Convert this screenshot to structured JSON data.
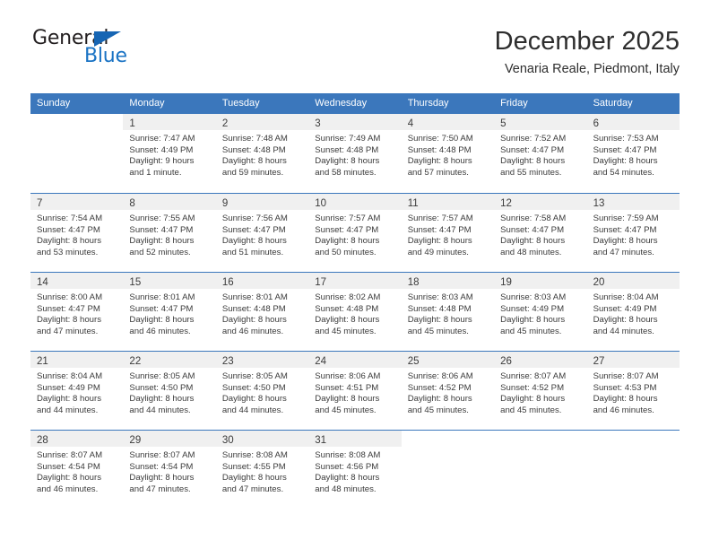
{
  "brand": {
    "name_part1": "General",
    "name_part2": "Blue",
    "triangle_color": "#1665b3",
    "blue_color": "#1a73c4"
  },
  "header": {
    "title": "December 2025",
    "subtitle": "Venaria Reale, Piedmont, Italy"
  },
  "theme": {
    "header_band": "#3b77bc",
    "daynum_band": "#f0f0f0",
    "text": "#3b3b3b"
  },
  "weekdays": [
    "Sunday",
    "Monday",
    "Tuesday",
    "Wednesday",
    "Thursday",
    "Friday",
    "Saturday"
  ],
  "weeks": [
    [
      {
        "empty": true
      },
      {
        "day": "1",
        "sunrise": "Sunrise: 7:47 AM",
        "sunset": "Sunset: 4:49 PM",
        "daylight1": "Daylight: 9 hours",
        "daylight2": "and 1 minute."
      },
      {
        "day": "2",
        "sunrise": "Sunrise: 7:48 AM",
        "sunset": "Sunset: 4:48 PM",
        "daylight1": "Daylight: 8 hours",
        "daylight2": "and 59 minutes."
      },
      {
        "day": "3",
        "sunrise": "Sunrise: 7:49 AM",
        "sunset": "Sunset: 4:48 PM",
        "daylight1": "Daylight: 8 hours",
        "daylight2": "and 58 minutes."
      },
      {
        "day": "4",
        "sunrise": "Sunrise: 7:50 AM",
        "sunset": "Sunset: 4:48 PM",
        "daylight1": "Daylight: 8 hours",
        "daylight2": "and 57 minutes."
      },
      {
        "day": "5",
        "sunrise": "Sunrise: 7:52 AM",
        "sunset": "Sunset: 4:47 PM",
        "daylight1": "Daylight: 8 hours",
        "daylight2": "and 55 minutes."
      },
      {
        "day": "6",
        "sunrise": "Sunrise: 7:53 AM",
        "sunset": "Sunset: 4:47 PM",
        "daylight1": "Daylight: 8 hours",
        "daylight2": "and 54 minutes."
      }
    ],
    [
      {
        "day": "7",
        "sunrise": "Sunrise: 7:54 AM",
        "sunset": "Sunset: 4:47 PM",
        "daylight1": "Daylight: 8 hours",
        "daylight2": "and 53 minutes."
      },
      {
        "day": "8",
        "sunrise": "Sunrise: 7:55 AM",
        "sunset": "Sunset: 4:47 PM",
        "daylight1": "Daylight: 8 hours",
        "daylight2": "and 52 minutes."
      },
      {
        "day": "9",
        "sunrise": "Sunrise: 7:56 AM",
        "sunset": "Sunset: 4:47 PM",
        "daylight1": "Daylight: 8 hours",
        "daylight2": "and 51 minutes."
      },
      {
        "day": "10",
        "sunrise": "Sunrise: 7:57 AM",
        "sunset": "Sunset: 4:47 PM",
        "daylight1": "Daylight: 8 hours",
        "daylight2": "and 50 minutes."
      },
      {
        "day": "11",
        "sunrise": "Sunrise: 7:57 AM",
        "sunset": "Sunset: 4:47 PM",
        "daylight1": "Daylight: 8 hours",
        "daylight2": "and 49 minutes."
      },
      {
        "day": "12",
        "sunrise": "Sunrise: 7:58 AM",
        "sunset": "Sunset: 4:47 PM",
        "daylight1": "Daylight: 8 hours",
        "daylight2": "and 48 minutes."
      },
      {
        "day": "13",
        "sunrise": "Sunrise: 7:59 AM",
        "sunset": "Sunset: 4:47 PM",
        "daylight1": "Daylight: 8 hours",
        "daylight2": "and 47 minutes."
      }
    ],
    [
      {
        "day": "14",
        "sunrise": "Sunrise: 8:00 AM",
        "sunset": "Sunset: 4:47 PM",
        "daylight1": "Daylight: 8 hours",
        "daylight2": "and 47 minutes."
      },
      {
        "day": "15",
        "sunrise": "Sunrise: 8:01 AM",
        "sunset": "Sunset: 4:47 PM",
        "daylight1": "Daylight: 8 hours",
        "daylight2": "and 46 minutes."
      },
      {
        "day": "16",
        "sunrise": "Sunrise: 8:01 AM",
        "sunset": "Sunset: 4:48 PM",
        "daylight1": "Daylight: 8 hours",
        "daylight2": "and 46 minutes."
      },
      {
        "day": "17",
        "sunrise": "Sunrise: 8:02 AM",
        "sunset": "Sunset: 4:48 PM",
        "daylight1": "Daylight: 8 hours",
        "daylight2": "and 45 minutes."
      },
      {
        "day": "18",
        "sunrise": "Sunrise: 8:03 AM",
        "sunset": "Sunset: 4:48 PM",
        "daylight1": "Daylight: 8 hours",
        "daylight2": "and 45 minutes."
      },
      {
        "day": "19",
        "sunrise": "Sunrise: 8:03 AM",
        "sunset": "Sunset: 4:49 PM",
        "daylight1": "Daylight: 8 hours",
        "daylight2": "and 45 minutes."
      },
      {
        "day": "20",
        "sunrise": "Sunrise: 8:04 AM",
        "sunset": "Sunset: 4:49 PM",
        "daylight1": "Daylight: 8 hours",
        "daylight2": "and 44 minutes."
      }
    ],
    [
      {
        "day": "21",
        "sunrise": "Sunrise: 8:04 AM",
        "sunset": "Sunset: 4:49 PM",
        "daylight1": "Daylight: 8 hours",
        "daylight2": "and 44 minutes."
      },
      {
        "day": "22",
        "sunrise": "Sunrise: 8:05 AM",
        "sunset": "Sunset: 4:50 PM",
        "daylight1": "Daylight: 8 hours",
        "daylight2": "and 44 minutes."
      },
      {
        "day": "23",
        "sunrise": "Sunrise: 8:05 AM",
        "sunset": "Sunset: 4:50 PM",
        "daylight1": "Daylight: 8 hours",
        "daylight2": "and 44 minutes."
      },
      {
        "day": "24",
        "sunrise": "Sunrise: 8:06 AM",
        "sunset": "Sunset: 4:51 PM",
        "daylight1": "Daylight: 8 hours",
        "daylight2": "and 45 minutes."
      },
      {
        "day": "25",
        "sunrise": "Sunrise: 8:06 AM",
        "sunset": "Sunset: 4:52 PM",
        "daylight1": "Daylight: 8 hours",
        "daylight2": "and 45 minutes."
      },
      {
        "day": "26",
        "sunrise": "Sunrise: 8:07 AM",
        "sunset": "Sunset: 4:52 PM",
        "daylight1": "Daylight: 8 hours",
        "daylight2": "and 45 minutes."
      },
      {
        "day": "27",
        "sunrise": "Sunrise: 8:07 AM",
        "sunset": "Sunset: 4:53 PM",
        "daylight1": "Daylight: 8 hours",
        "daylight2": "and 46 minutes."
      }
    ],
    [
      {
        "day": "28",
        "sunrise": "Sunrise: 8:07 AM",
        "sunset": "Sunset: 4:54 PM",
        "daylight1": "Daylight: 8 hours",
        "daylight2": "and 46 minutes."
      },
      {
        "day": "29",
        "sunrise": "Sunrise: 8:07 AM",
        "sunset": "Sunset: 4:54 PM",
        "daylight1": "Daylight: 8 hours",
        "daylight2": "and 47 minutes."
      },
      {
        "day": "30",
        "sunrise": "Sunrise: 8:08 AM",
        "sunset": "Sunset: 4:55 PM",
        "daylight1": "Daylight: 8 hours",
        "daylight2": "and 47 minutes."
      },
      {
        "day": "31",
        "sunrise": "Sunrise: 8:08 AM",
        "sunset": "Sunset: 4:56 PM",
        "daylight1": "Daylight: 8 hours",
        "daylight2": "and 48 minutes."
      },
      {
        "empty": true
      },
      {
        "empty": true
      },
      {
        "empty": true
      }
    ]
  ]
}
